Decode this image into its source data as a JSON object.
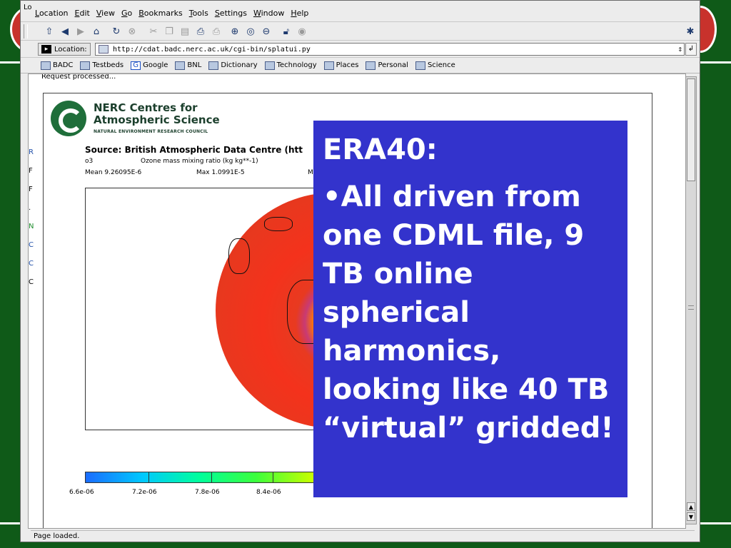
{
  "window": {
    "corner_label": "Lo",
    "menu": [
      "Location",
      "Edit",
      "View",
      "Go",
      "Bookmarks",
      "Tools",
      "Settings",
      "Window",
      "Help"
    ]
  },
  "toolbar": {
    "buttons": [
      "up-icon",
      "back-icon",
      "forward-icon",
      "home-icon",
      "reload-icon",
      "stop-icon",
      "cut-icon",
      "copy-icon",
      "paste-icon",
      "print-icon",
      "print-preview-icon",
      "zoom-in-icon",
      "zoom-normal-icon",
      "zoom-out-icon",
      "lock-icon",
      "find-icon"
    ]
  },
  "location_bar": {
    "label": "Location:",
    "url": "http://cdat.badc.nerc.ac.uk/cgi-bin/splatui.py"
  },
  "bookmarks": [
    "BADC",
    "Testbeds",
    "Google",
    "BNL",
    "Dictionary",
    "Technology",
    "Places",
    "Personal",
    "Science"
  ],
  "page": {
    "request_status": "Request processed...",
    "org_line1": "NERC Centres for",
    "org_line2": "Atmospheric Science",
    "org_line3": "NATURAL ENVIRONMENT RESEARCH COUNCIL",
    "source": "Source: British Atmospheric Data Centre (htt",
    "var_name": "o3",
    "var_desc": "Ozone mass mixing ratio (kg kg**-1)",
    "mean": "Mean 9.26095E-6",
    "max": "Max 1.0991E-5",
    "min_partial": "Mi",
    "colorbar_labels": [
      "6.6e-06",
      "7.2e-06",
      "7.8e-06",
      "8.4e-06"
    ],
    "left_margin_chars": [
      "R",
      "F",
      "F",
      ".",
      "N",
      "C",
      "C",
      "C"
    ]
  },
  "status": {
    "text": "Page loaded."
  },
  "overlay": {
    "title": "ERA40:",
    "body": "•All driven from one CDML file, 9 TB online spherical harmonics, looking like 40 TB “virtual” gridded!"
  },
  "colors": {
    "slide_background": "#0f5a18",
    "overlay_background": "#3333cc",
    "overlay_text": "#ffffff"
  }
}
